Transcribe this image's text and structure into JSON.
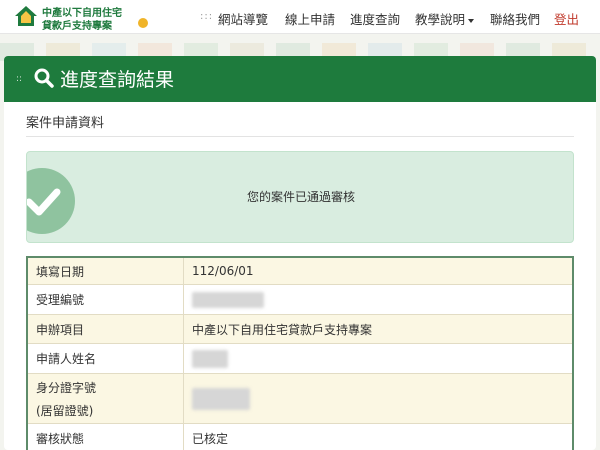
{
  "header": {
    "logo_line1": "中產以下自用住宅",
    "logo_line2": "貸款戶支持專案",
    "nav": [
      "網站導覽",
      "線上申請",
      "進度查詢",
      "教學說明",
      "聯絡我們",
      "登出"
    ]
  },
  "card": {
    "title": "進度查詢結果",
    "section_title": "案件申請資料",
    "alert_text": "您的案件已通過審核"
  },
  "table": {
    "rows": [
      {
        "label": "填寫日期",
        "value": "112/06/01"
      },
      {
        "label": "受理編號",
        "value": ""
      },
      {
        "label": "申辦項目",
        "value": "中產以下自用住宅貸款戶支持專案"
      },
      {
        "label": "申請人姓名",
        "value": ""
      },
      {
        "label": "身分證字號",
        "label2": "(居留證號)",
        "value": ""
      },
      {
        "label": "審核狀態",
        "value": "已核定"
      }
    ]
  },
  "colors": {
    "brand_green": "#1e7b3d",
    "alert_bg": "#d9ede0",
    "logout_red": "#c0392b"
  }
}
